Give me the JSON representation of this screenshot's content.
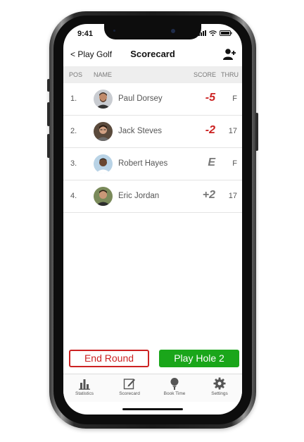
{
  "status_bar": {
    "time": "9:41"
  },
  "header": {
    "back_label": "< Play Golf",
    "title": "Scorecard"
  },
  "table": {
    "columns": {
      "pos": "POS",
      "name": "NAME",
      "score": "SCORE",
      "thru": "THRU"
    },
    "rows": [
      {
        "pos": "1.",
        "name": "Paul Dorsey",
        "score": "-5",
        "thru": "F"
      },
      {
        "pos": "2.",
        "name": "Jack Steves",
        "score": "-2",
        "thru": "17"
      },
      {
        "pos": "3.",
        "name": "Robert Hayes",
        "score": "E",
        "thru": "F"
      },
      {
        "pos": "4.",
        "name": "Eric Jordan",
        "score": "+2",
        "thru": "17"
      }
    ]
  },
  "actions": {
    "end_round": "End Round",
    "play_hole": "Play Hole 2"
  },
  "bottom_nav": {
    "items": [
      {
        "label": "Statistics",
        "icon": "bar-chart-icon"
      },
      {
        "label": "Scorecard",
        "icon": "edit-icon"
      },
      {
        "label": "Book Time",
        "icon": "golf-ball-tee-icon"
      },
      {
        "label": "Settings",
        "icon": "gear-icon"
      }
    ]
  },
  "colors": {
    "under_par": "#cc2222",
    "even_over_par": "#777777",
    "end_round": "#cc2222",
    "play_hole": "#1aa61a"
  }
}
